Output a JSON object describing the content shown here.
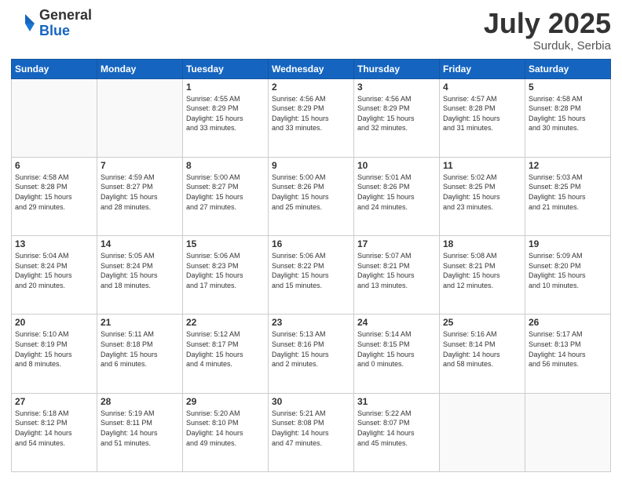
{
  "header": {
    "logo_general": "General",
    "logo_blue": "Blue",
    "month_title": "July 2025",
    "subtitle": "Surduk, Serbia"
  },
  "weekdays": [
    "Sunday",
    "Monday",
    "Tuesday",
    "Wednesday",
    "Thursday",
    "Friday",
    "Saturday"
  ],
  "weeks": [
    [
      {
        "day": "",
        "info": ""
      },
      {
        "day": "",
        "info": ""
      },
      {
        "day": "1",
        "info": "Sunrise: 4:55 AM\nSunset: 8:29 PM\nDaylight: 15 hours\nand 33 minutes."
      },
      {
        "day": "2",
        "info": "Sunrise: 4:56 AM\nSunset: 8:29 PM\nDaylight: 15 hours\nand 33 minutes."
      },
      {
        "day": "3",
        "info": "Sunrise: 4:56 AM\nSunset: 8:29 PM\nDaylight: 15 hours\nand 32 minutes."
      },
      {
        "day": "4",
        "info": "Sunrise: 4:57 AM\nSunset: 8:28 PM\nDaylight: 15 hours\nand 31 minutes."
      },
      {
        "day": "5",
        "info": "Sunrise: 4:58 AM\nSunset: 8:28 PM\nDaylight: 15 hours\nand 30 minutes."
      }
    ],
    [
      {
        "day": "6",
        "info": "Sunrise: 4:58 AM\nSunset: 8:28 PM\nDaylight: 15 hours\nand 29 minutes."
      },
      {
        "day": "7",
        "info": "Sunrise: 4:59 AM\nSunset: 8:27 PM\nDaylight: 15 hours\nand 28 minutes."
      },
      {
        "day": "8",
        "info": "Sunrise: 5:00 AM\nSunset: 8:27 PM\nDaylight: 15 hours\nand 27 minutes."
      },
      {
        "day": "9",
        "info": "Sunrise: 5:00 AM\nSunset: 8:26 PM\nDaylight: 15 hours\nand 25 minutes."
      },
      {
        "day": "10",
        "info": "Sunrise: 5:01 AM\nSunset: 8:26 PM\nDaylight: 15 hours\nand 24 minutes."
      },
      {
        "day": "11",
        "info": "Sunrise: 5:02 AM\nSunset: 8:25 PM\nDaylight: 15 hours\nand 23 minutes."
      },
      {
        "day": "12",
        "info": "Sunrise: 5:03 AM\nSunset: 8:25 PM\nDaylight: 15 hours\nand 21 minutes."
      }
    ],
    [
      {
        "day": "13",
        "info": "Sunrise: 5:04 AM\nSunset: 8:24 PM\nDaylight: 15 hours\nand 20 minutes."
      },
      {
        "day": "14",
        "info": "Sunrise: 5:05 AM\nSunset: 8:24 PM\nDaylight: 15 hours\nand 18 minutes."
      },
      {
        "day": "15",
        "info": "Sunrise: 5:06 AM\nSunset: 8:23 PM\nDaylight: 15 hours\nand 17 minutes."
      },
      {
        "day": "16",
        "info": "Sunrise: 5:06 AM\nSunset: 8:22 PM\nDaylight: 15 hours\nand 15 minutes."
      },
      {
        "day": "17",
        "info": "Sunrise: 5:07 AM\nSunset: 8:21 PM\nDaylight: 15 hours\nand 13 minutes."
      },
      {
        "day": "18",
        "info": "Sunrise: 5:08 AM\nSunset: 8:21 PM\nDaylight: 15 hours\nand 12 minutes."
      },
      {
        "day": "19",
        "info": "Sunrise: 5:09 AM\nSunset: 8:20 PM\nDaylight: 15 hours\nand 10 minutes."
      }
    ],
    [
      {
        "day": "20",
        "info": "Sunrise: 5:10 AM\nSunset: 8:19 PM\nDaylight: 15 hours\nand 8 minutes."
      },
      {
        "day": "21",
        "info": "Sunrise: 5:11 AM\nSunset: 8:18 PM\nDaylight: 15 hours\nand 6 minutes."
      },
      {
        "day": "22",
        "info": "Sunrise: 5:12 AM\nSunset: 8:17 PM\nDaylight: 15 hours\nand 4 minutes."
      },
      {
        "day": "23",
        "info": "Sunrise: 5:13 AM\nSunset: 8:16 PM\nDaylight: 15 hours\nand 2 minutes."
      },
      {
        "day": "24",
        "info": "Sunrise: 5:14 AM\nSunset: 8:15 PM\nDaylight: 15 hours\nand 0 minutes."
      },
      {
        "day": "25",
        "info": "Sunrise: 5:16 AM\nSunset: 8:14 PM\nDaylight: 14 hours\nand 58 minutes."
      },
      {
        "day": "26",
        "info": "Sunrise: 5:17 AM\nSunset: 8:13 PM\nDaylight: 14 hours\nand 56 minutes."
      }
    ],
    [
      {
        "day": "27",
        "info": "Sunrise: 5:18 AM\nSunset: 8:12 PM\nDaylight: 14 hours\nand 54 minutes."
      },
      {
        "day": "28",
        "info": "Sunrise: 5:19 AM\nSunset: 8:11 PM\nDaylight: 14 hours\nand 51 minutes."
      },
      {
        "day": "29",
        "info": "Sunrise: 5:20 AM\nSunset: 8:10 PM\nDaylight: 14 hours\nand 49 minutes."
      },
      {
        "day": "30",
        "info": "Sunrise: 5:21 AM\nSunset: 8:08 PM\nDaylight: 14 hours\nand 47 minutes."
      },
      {
        "day": "31",
        "info": "Sunrise: 5:22 AM\nSunset: 8:07 PM\nDaylight: 14 hours\nand 45 minutes."
      },
      {
        "day": "",
        "info": ""
      },
      {
        "day": "",
        "info": ""
      }
    ]
  ]
}
